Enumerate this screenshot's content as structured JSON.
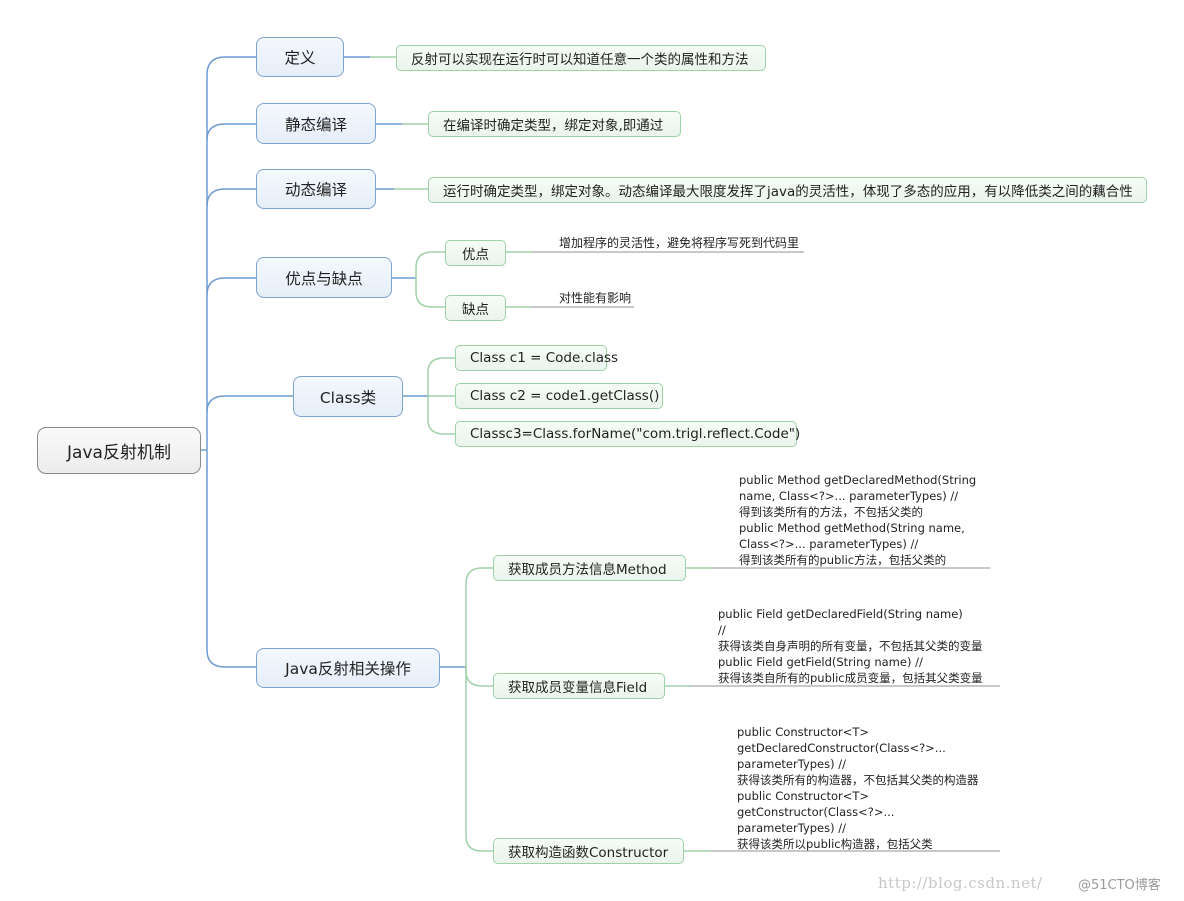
{
  "root": {
    "label": "Java反射机制"
  },
  "branches": [
    {
      "label": "定义",
      "children": [
        {
          "label": "反射可以实现在运行时可以知道任意一个类的属性和方法"
        }
      ]
    },
    {
      "label": "静态编译",
      "children": [
        {
          "label": "在编译时确定类型，绑定对象,即通过"
        }
      ]
    },
    {
      "label": "动态编译",
      "children": [
        {
          "label": "运行时确定类型，绑定对象。动态编译最大限度发挥了java的灵活性，体现了多态的应用，有以降低类之间的藕合性"
        }
      ]
    },
    {
      "label": "优点与缺点",
      "children": [
        {
          "label": "优点",
          "note": "增加程序的灵活性，避免将程序写死到代码里"
        },
        {
          "label": "缺点",
          "note": "对性能有影响"
        }
      ]
    },
    {
      "label": "Class类",
      "children": [
        {
          "label": "Class c1 = Code.class"
        },
        {
          "label": "Class c2 = code1.getClass()"
        },
        {
          "label": "Classc3=Class.forName(\"com.trigl.reflect.Code\")"
        }
      ]
    },
    {
      "label": "Java反射相关操作",
      "children": [
        {
          "label": "获取成员方法信息Method",
          "note": "public Method getDeclaredMethod(String\nname, Class<?>... parameterTypes) //\n得到该类所有的方法，不包括父类的\npublic Method getMethod(String name,\nClass<?>... parameterTypes) //\n得到该类所有的public方法，包括父类的"
        },
        {
          "label": "获取成员变量信息Field",
          "note": "public Field getDeclaredField(String name)\n//\n获得该类自身声明的所有变量，不包括其父类的变量\npublic Field getField(String name) //\n获得该类自所有的public成员变量，包括其父类变量"
        },
        {
          "label": "获取构造函数Constructor",
          "note": "public Constructor<T>\ngetDeclaredConstructor(Class<?>...\nparameterTypes) //\n获得该类所有的构造器，不包括其父类的构造器\npublic Constructor<T>\ngetConstructor(Class<?>...\nparameterTypes) //\n获得该类所以public构造器，包括父类"
        }
      ]
    }
  ],
  "watermark": {
    "url": "http://blog.csdn.net/",
    "brand": "@51CTO博客"
  },
  "colors": {
    "main_line": "#6f9bd1",
    "leaf_line": "#9fd2a9",
    "note_line": "#a8a8a8"
  }
}
